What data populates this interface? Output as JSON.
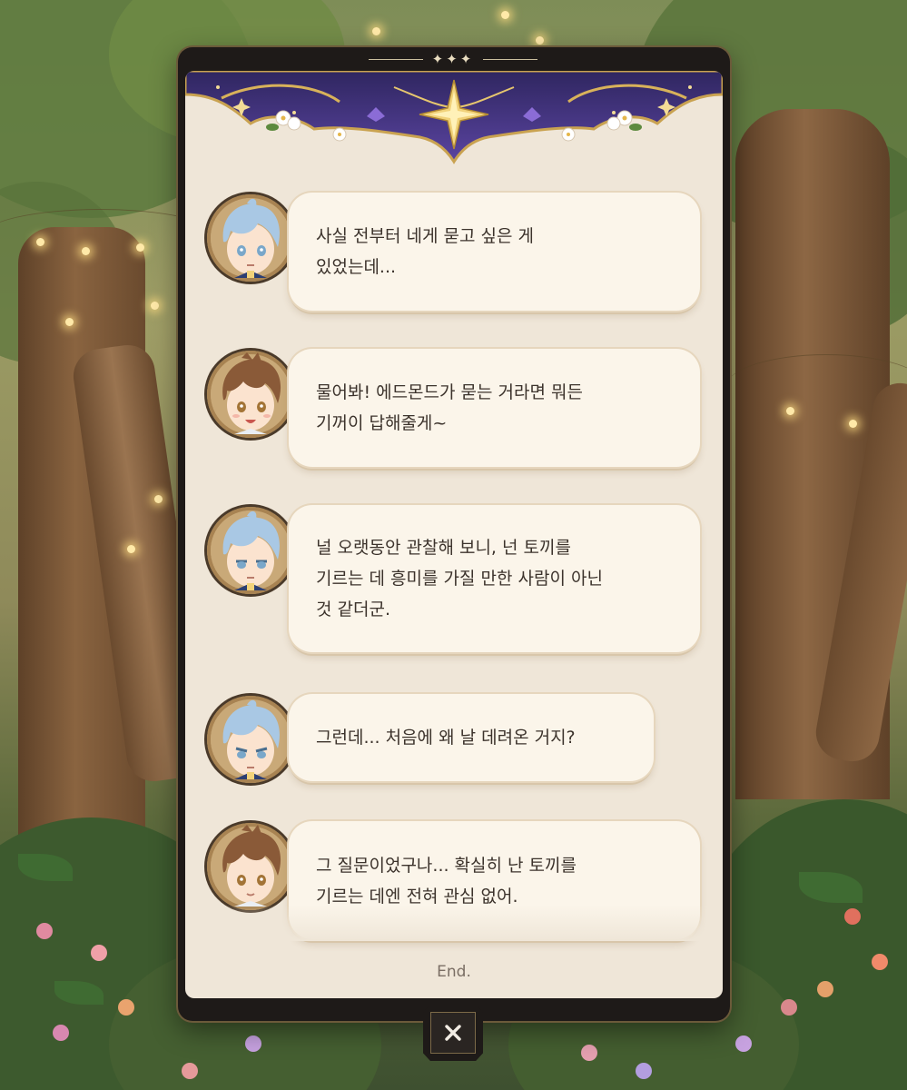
{
  "dialogue": {
    "messages": [
      {
        "speaker": "blue-hair",
        "text": "사실 전부터 네게 묻고 싶은 게\n있었는데..."
      },
      {
        "speaker": "brown-hair",
        "text": "물어봐! 에드몬드가 묻는 거라면 뭐든\n기꺼이 답해줄게~"
      },
      {
        "speaker": "blue-hair",
        "text": "널 오랫동안 관찰해 보니, 넌 토끼를\n기르는 데 흥미를 가질 만한 사람이 아닌\n것 같더군."
      },
      {
        "speaker": "blue-hair",
        "text": "그런데... 처음에 왜 날 데려온 거지?"
      },
      {
        "speaker": "brown-hair",
        "text": "그 질문이었구나... 확실히 난 토끼를\n기르는 데엔 전혀 관심 없어."
      }
    ],
    "end_label": "End."
  },
  "colors": {
    "panel": "#efe6d8",
    "bubble": "#fbf5ea",
    "frame": "#1e1a18",
    "text": "#3c332c",
    "header_purple": "#4b3a86",
    "gold": "#d8b25a"
  },
  "icons": {
    "close": "close-icon",
    "header_star": "star-icon"
  }
}
